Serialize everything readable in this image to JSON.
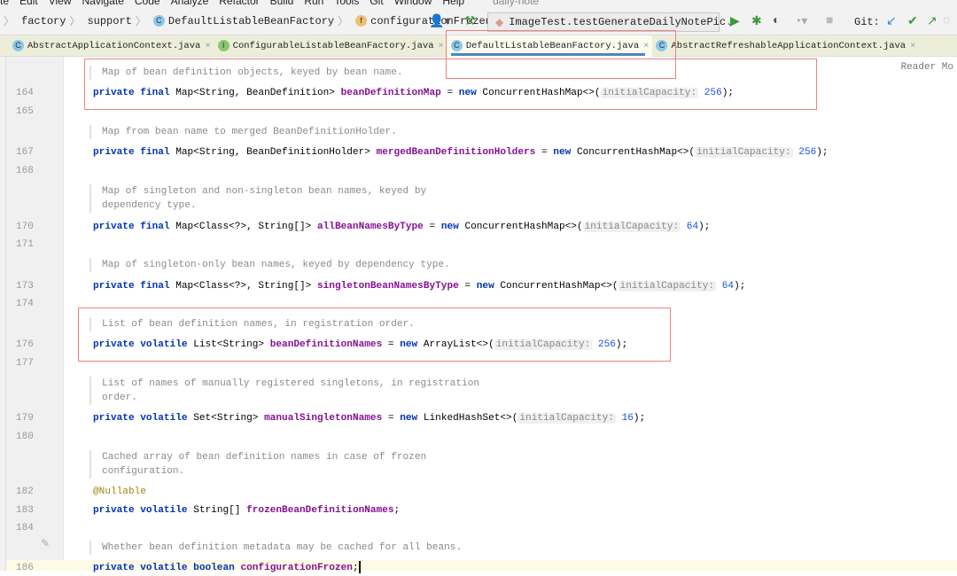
{
  "menu": {
    "items": [
      "te",
      "Edit",
      "View",
      "Navigate",
      "Code",
      "Analyze",
      "Refactor",
      "Build",
      "Run",
      "Tools",
      "Git",
      "Window",
      "Help"
    ],
    "project": "daily-note"
  },
  "breadcrumb": {
    "items": [
      "factory",
      "support",
      "DefaultListableBeanFactory",
      "configurationFrozen"
    ]
  },
  "run_config": "ImageTest.testGenerateDailyNotePic",
  "git_label": "Git:",
  "tabs": [
    {
      "label": "AbstractApplicationContext.java",
      "icon": "C"
    },
    {
      "label": "ConfigurableListableBeanFactory.java",
      "icon": "I"
    },
    {
      "label": "DefaultListableBeanFactory.java",
      "icon": "C",
      "active": true
    },
    {
      "label": "AbstractRefreshableApplicationContext.java",
      "icon": "C"
    }
  ],
  "reader_mode": "Reader Mo",
  "rows": [
    {
      "doc": "Map of bean definition objects, keyed by bean name."
    },
    {
      "ln": "164",
      "code": [
        [
          "kw",
          "private final "
        ],
        [
          "ty",
          "Map<String, BeanDefinition> "
        ],
        [
          "fld",
          "beanDefinitionMap"
        ],
        [
          "ty",
          " = "
        ],
        [
          "kw",
          "new "
        ],
        [
          "ty",
          "ConcurrentHashMap<>("
        ],
        [
          "hint",
          "initialCapacity:"
        ],
        [
          "num",
          " 256"
        ],
        [
          "ty",
          ");"
        ]
      ]
    },
    {
      "ln": "165"
    },
    {
      "doc": "Map from bean name to merged BeanDefinitionHolder."
    },
    {
      "ln": "167",
      "code": [
        [
          "kw",
          "private final "
        ],
        [
          "ty",
          "Map<String, BeanDefinitionHolder> "
        ],
        [
          "fld",
          "mergedBeanDefinitionHolders"
        ],
        [
          "ty",
          " = "
        ],
        [
          "kw",
          "new "
        ],
        [
          "ty",
          "ConcurrentHashMap<>("
        ],
        [
          "hint",
          "initialCapacity:"
        ],
        [
          "num",
          " 256"
        ],
        [
          "ty",
          ");"
        ]
      ]
    },
    {
      "ln": "168"
    },
    {
      "doc": "Map of singleton and non-singleton bean names, keyed by\ndependency type."
    },
    {
      "ln": "170",
      "code": [
        [
          "kw",
          "private final "
        ],
        [
          "ty",
          "Map<Class<?>, String[]> "
        ],
        [
          "fld",
          "allBeanNamesByType"
        ],
        [
          "ty",
          " = "
        ],
        [
          "kw",
          "new "
        ],
        [
          "ty",
          "ConcurrentHashMap<>("
        ],
        [
          "hint",
          "initialCapacity:"
        ],
        [
          "num",
          " 64"
        ],
        [
          "ty",
          ");"
        ]
      ]
    },
    {
      "ln": "171"
    },
    {
      "doc": "Map of singleton-only bean names, keyed by dependency type."
    },
    {
      "ln": "173",
      "code": [
        [
          "kw",
          "private final "
        ],
        [
          "ty",
          "Map<Class<?>, String[]> "
        ],
        [
          "fld",
          "singletonBeanNamesByType"
        ],
        [
          "ty",
          " = "
        ],
        [
          "kw",
          "new "
        ],
        [
          "ty",
          "ConcurrentHashMap<>("
        ],
        [
          "hint",
          "initialCapacity:"
        ],
        [
          "num",
          " 64"
        ],
        [
          "ty",
          ");"
        ]
      ]
    },
    {
      "ln": "174"
    },
    {
      "doc": "List of bean definition names, in registration order."
    },
    {
      "ln": "176",
      "code": [
        [
          "kw",
          "private volatile "
        ],
        [
          "ty",
          "List<String> "
        ],
        [
          "fld",
          "beanDefinitionNames"
        ],
        [
          "ty",
          " = "
        ],
        [
          "kw",
          "new "
        ],
        [
          "ty",
          "ArrayList<>("
        ],
        [
          "hint",
          "initialCapacity:"
        ],
        [
          "num",
          " 256"
        ],
        [
          "ty",
          ");"
        ]
      ]
    },
    {
      "ln": "177"
    },
    {
      "doc": "List of names of manually registered singletons, in registration\norder."
    },
    {
      "ln": "179",
      "code": [
        [
          "kw",
          "private volatile "
        ],
        [
          "ty",
          "Set<String> "
        ],
        [
          "fld",
          "manualSingletonNames"
        ],
        [
          "ty",
          " = "
        ],
        [
          "kw",
          "new "
        ],
        [
          "ty",
          "LinkedHashSet<>("
        ],
        [
          "hint",
          "initialCapacity:"
        ],
        [
          "num",
          " 16"
        ],
        [
          "ty",
          ");"
        ]
      ]
    },
    {
      "ln": "180"
    },
    {
      "doc": "Cached array of bean definition names in case of frozen\nconfiguration."
    },
    {
      "ln": "182",
      "code": [
        [
          "ann",
          "@Nullable"
        ]
      ]
    },
    {
      "ln": "183",
      "code": [
        [
          "kw",
          "private volatile "
        ],
        [
          "ty",
          "String[] "
        ],
        [
          "fld",
          "frozenBeanDefinitionNames"
        ],
        [
          "ty",
          ";"
        ]
      ]
    },
    {
      "ln": "184"
    },
    {
      "doc": "Whether bean definition metadata may be cached for all beans."
    },
    {
      "ln": "186",
      "code": [
        [
          "kw",
          "private volatile boolean "
        ],
        [
          "fld",
          "configurationFrozen"
        ],
        [
          "ty",
          ";"
        ]
      ]
    }
  ]
}
